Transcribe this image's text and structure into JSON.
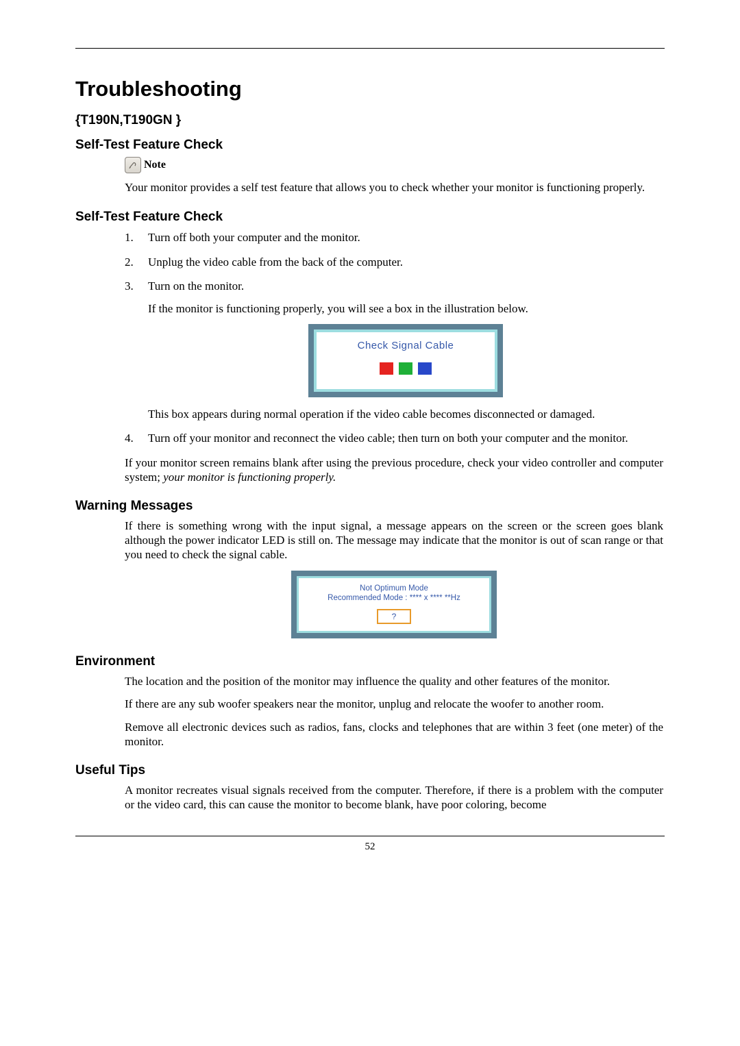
{
  "page_number": "52",
  "title": "Troubleshooting",
  "model_line": "{T190N,T190GN }",
  "note_label": "Note",
  "self_test_1": {
    "heading": "Self-Test Feature Check",
    "note_para": "Your monitor provides a self test feature that allows you to check whether your monitor is functioning properly."
  },
  "self_test_2": {
    "heading": "Self-Test Feature Check",
    "steps": {
      "s1": "Turn off both your computer and the monitor.",
      "s2": "Unplug the video cable from the back of the computer.",
      "s3": "Turn on the monitor.",
      "s3_sub": "If the monitor is functioning properly, you will see a box in the illustration below.",
      "s3_post": "This box appears during normal operation if the video cable becomes disconnected or damaged.",
      "s4": "Turn off your monitor and reconnect the video cable; then turn on both your computer and the monitor."
    },
    "closing_plain": "If your monitor screen remains blank after using the previous procedure, check your video controller and computer system; ",
    "closing_italic": "your monitor is functioning properly."
  },
  "fig1": {
    "title": "Check Signal Cable"
  },
  "warning": {
    "heading": "Warning Messages",
    "para": "If there is something wrong with the input signal, a message appears on the screen or the screen goes blank although the power indicator LED is still on. The message may indicate that the monitor is out of scan range or that you need to check the signal cable."
  },
  "fig2": {
    "line1": "Not Optimum Mode",
    "line2": "Recommended Mode : **** x ****  **Hz",
    "button": "?"
  },
  "environment": {
    "heading": "Environment",
    "p1": "The location and the position of the monitor may influence the quality and other features of the monitor.",
    "p2": "If there are any sub woofer speakers near the monitor, unplug and relocate the woofer to another room.",
    "p3": "Remove all electronic devices such as radios, fans, clocks and telephones that are within 3 feet (one meter) of the monitor."
  },
  "useful_tips": {
    "heading": "Useful Tips",
    "p1": "A monitor recreates visual signals received from the computer. Therefore, if there is a problem with the computer or the video card, this can cause the monitor to become blank, have poor coloring, become"
  }
}
